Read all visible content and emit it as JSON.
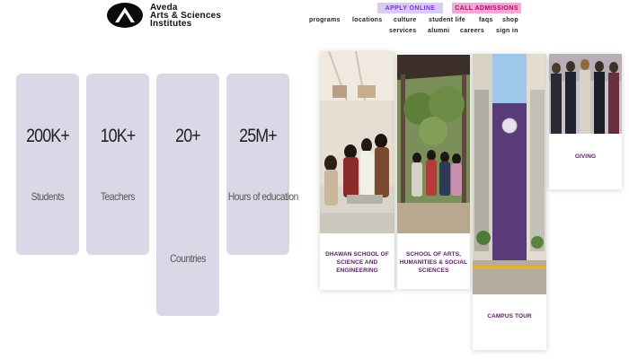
{
  "brand": {
    "line1": "Aveda",
    "line2": "Arts & Sciences",
    "line3": "Institutes"
  },
  "cta": {
    "apply": "APPLY ONLINE",
    "call": "CALL ADMISSIONS"
  },
  "nav": {
    "row1": [
      "programs",
      "locations",
      "culture",
      "student life",
      "faqs",
      "shop"
    ],
    "row2": [
      "services",
      "alumni",
      "careers",
      "sign in"
    ]
  },
  "stats": [
    {
      "number": "200K+",
      "label": "Students"
    },
    {
      "number": "10K+",
      "label": "Teachers"
    },
    {
      "number": "20+",
      "label": "Countries"
    },
    {
      "number": "25M+",
      "label": "Hours of education"
    }
  ],
  "cards": [
    {
      "caption": "DHAWAN SCHOOL OF SCIENCE AND ENGINEERING",
      "image": "students-lab-photo"
    },
    {
      "caption": "SCHOOL OF ARTS, HUMANITIES & SOCIAL SCIENCES",
      "image": "students-garden-photo"
    },
    {
      "caption": "CAMPUS TOUR",
      "image": "campus-building-photo"
    },
    {
      "caption": "GIVING",
      "image": "donors-group-photo"
    }
  ],
  "colors": {
    "stat_bg": "#d9d8e6",
    "apply_bg": "#d6cdef",
    "call_bg": "#f3a6d8",
    "caption": "#5a1a66"
  }
}
